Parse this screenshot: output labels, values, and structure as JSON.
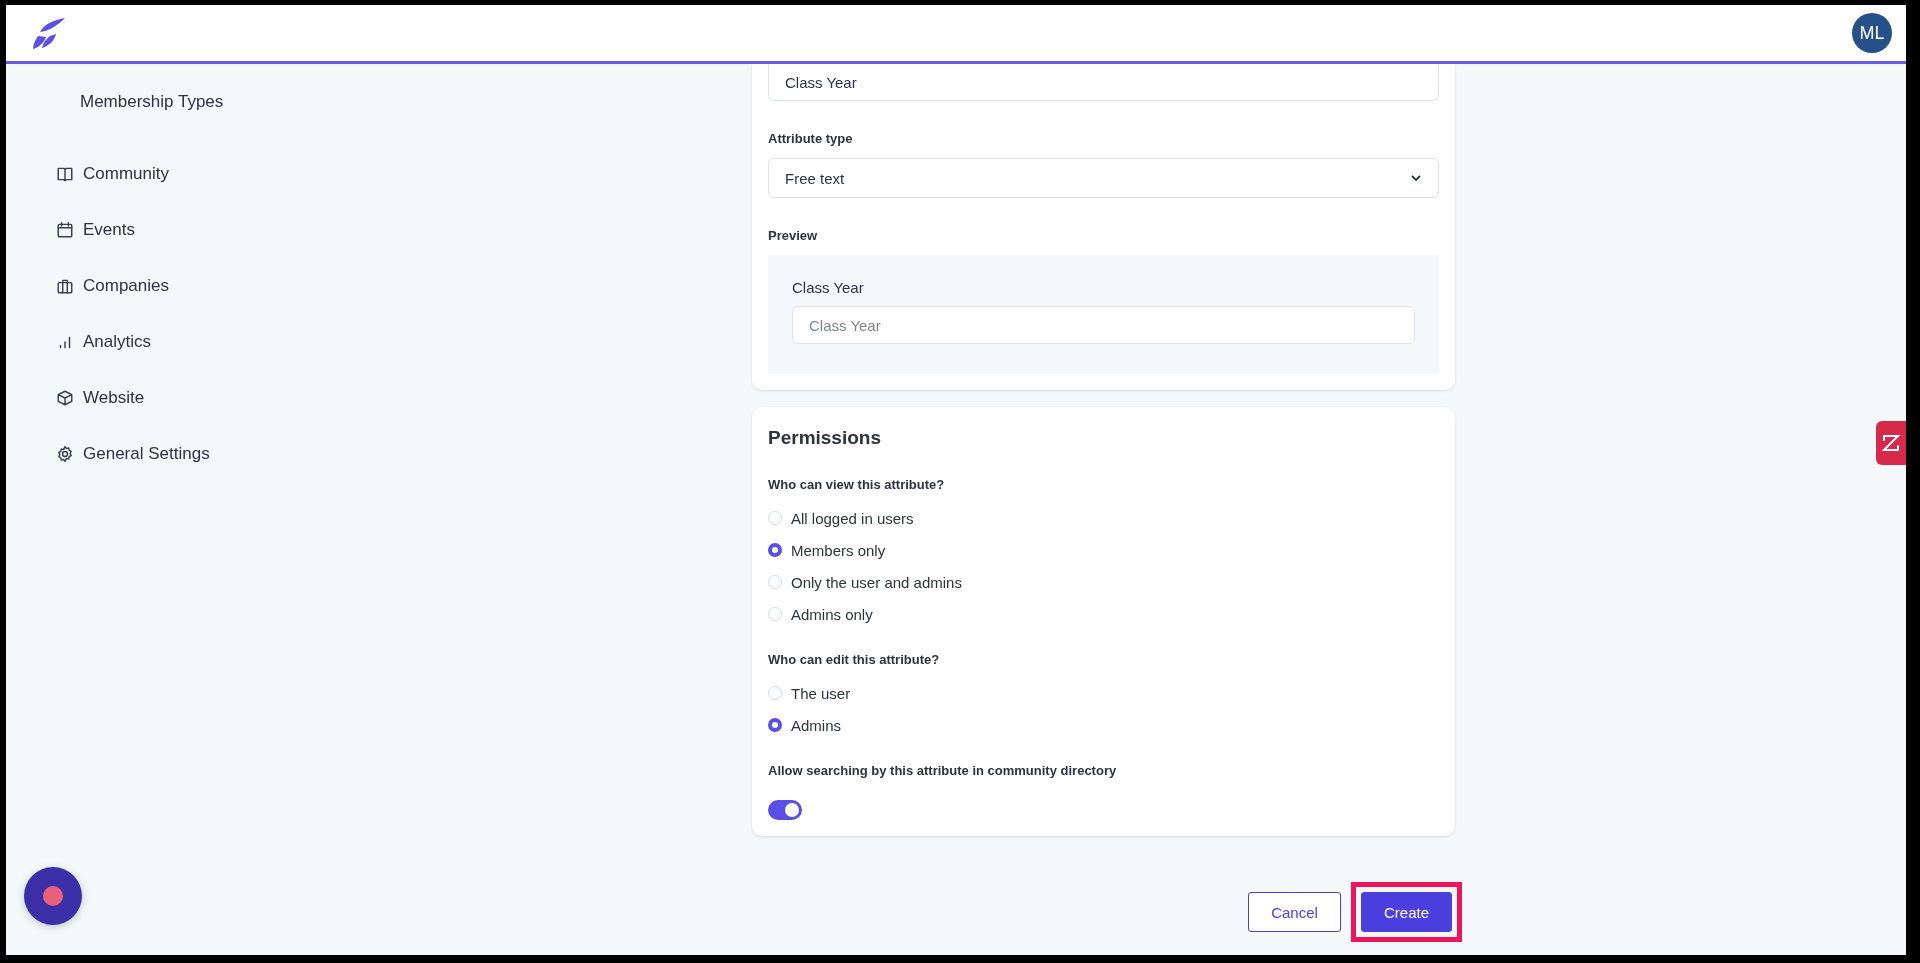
{
  "header": {
    "avatar": "ML"
  },
  "sidebar": {
    "items": [
      {
        "label": "Membership Types",
        "kind": "sub"
      },
      {
        "label": "Community",
        "kind": "book"
      },
      {
        "label": "Events",
        "kind": "calendar"
      },
      {
        "label": "Companies",
        "kind": "briefcase"
      },
      {
        "label": "Analytics",
        "kind": "chart"
      },
      {
        "label": "Website",
        "kind": "cube"
      },
      {
        "label": "General Settings",
        "kind": "gear"
      }
    ]
  },
  "attribute_form": {
    "name_value": "Class Year",
    "type_label": "Attribute type",
    "type_value": "Free text",
    "preview_label": "Preview",
    "preview_field_label": "Class Year",
    "preview_placeholder": "Class Year"
  },
  "permissions": {
    "title": "Permissions",
    "view": {
      "question": "Who can view this attribute?",
      "options": [
        {
          "label": "All logged in users",
          "selected": false
        },
        {
          "label": "Members only",
          "selected": true
        },
        {
          "label": "Only the user and admins",
          "selected": false
        },
        {
          "label": "Admins only",
          "selected": false
        }
      ]
    },
    "edit": {
      "question": "Who can edit this attribute?",
      "options": [
        {
          "label": "The user",
          "selected": false
        },
        {
          "label": "Admins",
          "selected": true
        }
      ]
    },
    "search_toggle": {
      "label": "Allow searching by this attribute in community directory",
      "on": true
    }
  },
  "buttons": [
    {
      "label": "Cancel",
      "kind": "secondary",
      "highlighted": false
    },
    {
      "label": "Create",
      "kind": "primary",
      "highlighted": true
    }
  ]
}
